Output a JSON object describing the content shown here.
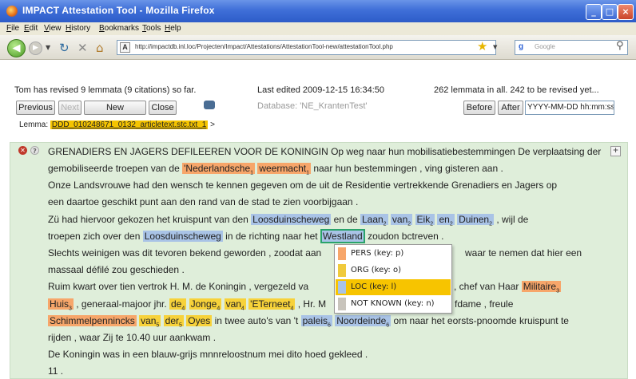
{
  "window": {
    "title": "IMPACT Attestation Tool - Mozilla Firefox",
    "controls": [
      "_",
      "□",
      "×"
    ]
  },
  "menubar": [
    "File",
    "Edit",
    "View",
    "History",
    "Bookmarks",
    "Tools",
    "Help"
  ],
  "navbar": {
    "url": "http://impactdb.inl.loc/Projecten/Impact/Attestations/AttestationTool-new/attestationTool.php",
    "favicon_letter": "A",
    "search_placeholder": "Google",
    "search_engine_letter": "g"
  },
  "toolbar": {
    "status_left": "Tom has revised 9 lemmata (9 citations) so far.",
    "status_mid": "Last edited 2009-12-15 16:34:50",
    "status_right": "262 lemmata in all. 242 to be revised yet...",
    "previous": "Previous",
    "next": "Next",
    "new": "New",
    "close": "Close",
    "database": "Database: 'NE_KrantenTest'",
    "before": "Before",
    "after": "After",
    "date_value": "YYYY-MM-DD hh:mm:ss"
  },
  "lemma": {
    "label": "Lemma:",
    "value": "DDD_010248671_0132_articletext.stc.txt_1",
    "arrow": ">"
  },
  "panel": {
    "plus": "+",
    "line1": {
      "a": "GRENADIERS EN JAGERS DEFILEEREN VOOR DE KONINGIN Op weg naar hun mobilisatiebestemmingen De verplaatsing der"
    },
    "line2": {
      "a": "gemobiliseerde troepen van de",
      "b": "'Nederlandsche",
      "b_sub": "1",
      "c": "weermacht",
      "c_sub": "1",
      "d": "naar hun bestemmingen , ving gisteren aan ."
    },
    "line3": {
      "a": "Onze Landsvrouwe had den wensch te kennen gegeven om de uit de Residentie vertrekkende Grenadiers en Jagers op"
    },
    "line4": {
      "a": "een daartoe geschikt punt aan den rand van de stad te zien voorbijgaan ."
    },
    "line5": {
      "a": "Zü had hiervoor gekozen het kruispunt van den",
      "b": "Loosduinscheweg",
      "c": "en de",
      "d": "Laan",
      "d_sub": "2",
      "e": "van",
      "e_sub": "2",
      "f": "Eik",
      "f_sub": "2",
      "g": "en",
      "g_sub": "2",
      "h": "Duinen",
      "h_sub": "2",
      "i": ", wijl de"
    },
    "line6": {
      "a": "troepen zich over den",
      "b": "Loosduinscheweg",
      "c": "in de richting naar het",
      "d": "Westland",
      "e": "zoudon bctreven ."
    },
    "line7": {
      "a": "Slechts weinigen was dit tevoren bekend geworden , zoodat aan",
      "b": "waar te nemen dat hier een"
    },
    "line8": {
      "a": "massaal défilé zou geschieden ."
    },
    "line9": {
      "a": "Ruim kwart over tien vertrok H. M. de Koningin , vergezeld va",
      "b": ", chef van Haar",
      "c": "Militaire",
      "c_sub": "3"
    },
    "line10": {
      "a": "Huis",
      "a_sub": "3",
      "b": ", generaal-majoor jhr.",
      "c": "de",
      "c_sub": "4",
      "d": "Jonge",
      "d_sub": "4",
      "e": "van",
      "e_sub": "4",
      "f": "'ETerneet",
      "f_sub": "4",
      "g": ", Hr. M",
      "h": "fdame , freule"
    },
    "line11": {
      "a": "Schimmelpennincks",
      "b": "van",
      "b_sub": "5",
      "c": "der",
      "c_sub": "5",
      "d": "Oyes",
      "e": "in twee auto's van 't",
      "f": "paleis",
      "f_sub": "6",
      "g": "Noordeinde",
      "g_sub": "6",
      "h": "om naar het eorsts-pnoomde kruispunt te"
    },
    "line12": {
      "a": "rijden , waar Zij te 10.40 uur aankwam ."
    },
    "line13": {
      "a": "De Koningin was in een blauw-grijs mnnreloostnum mei dito hoed gekleed ."
    },
    "line14": {
      "a": "11 ."
    }
  },
  "context_menu": {
    "items": [
      {
        "label": "PERS (key: p)",
        "color": "#f7a66a"
      },
      {
        "label": "ORG (key: o)",
        "color": "#f0ca3c"
      },
      {
        "label": "LOC (key: l)",
        "color": "#a9c3e6"
      },
      {
        "label": "NOT KNOWN (key: n)",
        "color": "#c8c4bc"
      }
    ]
  },
  "colors": {
    "person": "#f7a66a",
    "organization": "#f7d23a",
    "location": "#a9c3e6",
    "panel_bg": "#dfeeda",
    "active_menu": "#f7c400"
  }
}
